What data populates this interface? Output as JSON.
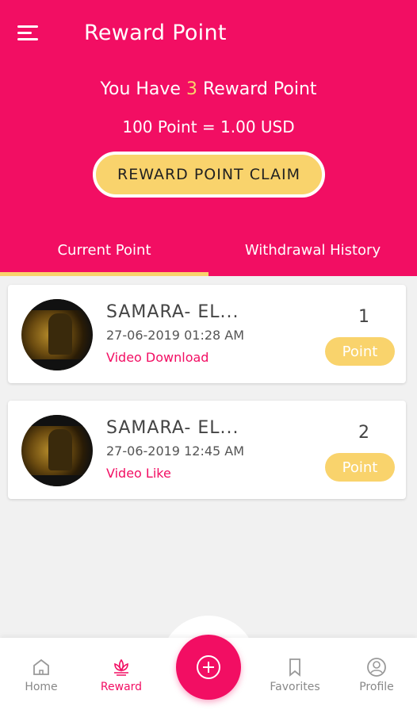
{
  "header": {
    "title": "Reward Point",
    "reward_prefix": "You Have",
    "reward_points": "3",
    "reward_suffix": "Reward Point",
    "rate": "100 Point = 1.00 USD",
    "claim_button": "REWARD POINT CLAIM"
  },
  "tabs": [
    {
      "label": "Current Point",
      "active": true
    },
    {
      "label": "Withdrawal History",
      "active": false
    }
  ],
  "items": [
    {
      "title": "SAMARA- EL...",
      "date": "27-06-2019",
      "time": "01:28 AM",
      "type": "Video Download",
      "points": "1",
      "badge": "Point"
    },
    {
      "title": "SAMARA- EL...",
      "date": "27-06-2019",
      "time": "12:45 AM",
      "type": "Video Like",
      "points": "2",
      "badge": "Point"
    }
  ],
  "nav": {
    "home": "Home",
    "reward": "Reward",
    "favorites": "Favorites",
    "profile": "Profile"
  },
  "icons": {
    "menu": "menu-icon",
    "home": "home-icon",
    "reward": "lotus-icon",
    "add": "plus-circle-icon",
    "favorites": "bookmark-icon",
    "profile": "user-icon"
  },
  "colors": {
    "primary": "#f20e63",
    "accent": "#f9d36c",
    "background": "#f1f1f1"
  }
}
